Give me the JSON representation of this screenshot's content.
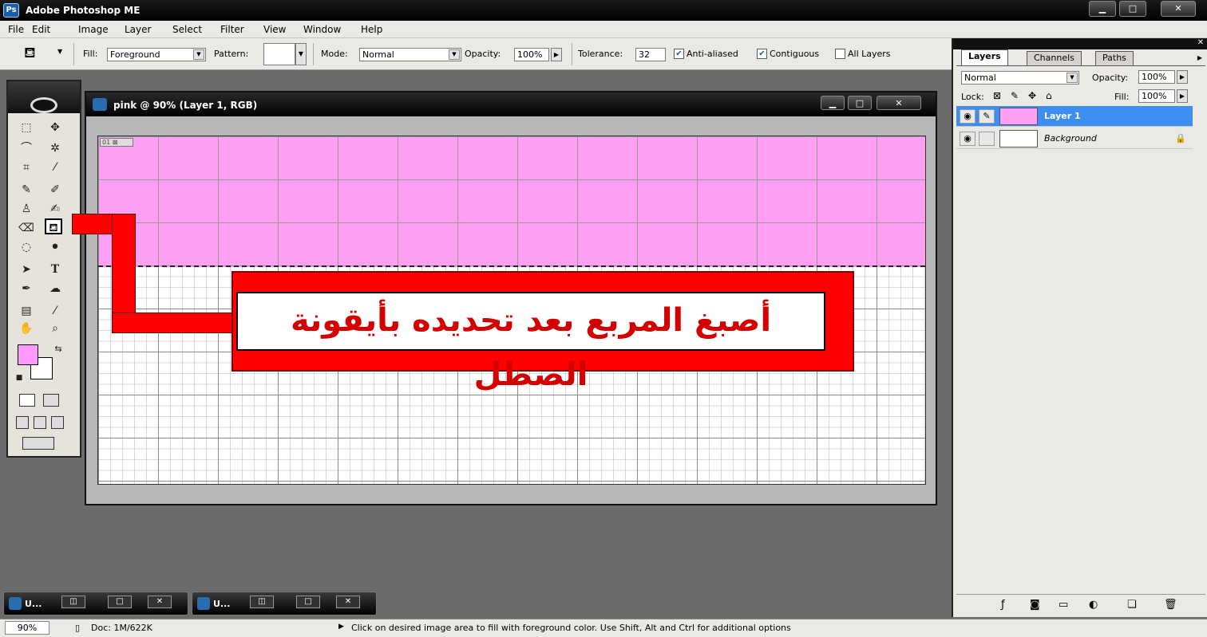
{
  "app": {
    "title": "Adobe Photoshop ME"
  },
  "menu": [
    "File",
    "Edit",
    "Image",
    "Layer",
    "Select",
    "Filter",
    "View",
    "Window",
    "Help"
  ],
  "options": {
    "fill_label": "Fill:",
    "fill_value": "Foreground",
    "pattern_label": "Pattern:",
    "mode_label": "Mode:",
    "mode_value": "Normal",
    "opacity_label": "Opacity:",
    "opacity_value": "100%",
    "tolerance_label": "Tolerance:",
    "tolerance_value": "32",
    "anti_aliased_label": "Anti-aliased",
    "anti_aliased_checked": true,
    "contiguous_label": "Contiguous",
    "contiguous_checked": true,
    "all_layers_label": "All Layers",
    "all_layers_checked": false
  },
  "document": {
    "title": "pink @ 90% (Layer 1, RGB)",
    "slice_tag": "01",
    "fill_color": "#ff9ff4"
  },
  "annotation": {
    "text": "أصبغ المربع بعد تحديده بأيقونة الصطل",
    "color": "#ff0000"
  },
  "foreground_color": "#ff99ff",
  "panel": {
    "tabs": [
      "Layers",
      "Channels",
      "Paths"
    ],
    "blend_mode": "Normal",
    "opacity_label": "Opacity:",
    "opacity_value": "100%",
    "lock_label": "Lock:",
    "fill_label": "Fill:",
    "fill_value": "100%",
    "layers": [
      {
        "name": "Layer 1",
        "selected": true
      },
      {
        "name": "Background",
        "selected": false
      }
    ]
  },
  "taskbar": [
    {
      "label": "U..."
    },
    {
      "label": "U..."
    }
  ],
  "status": {
    "zoom": "90%",
    "doc": "Doc: 1M/622K",
    "hint": "Click on desired image area to fill with foreground color.  Use Shift, Alt and Ctrl for additional options"
  }
}
